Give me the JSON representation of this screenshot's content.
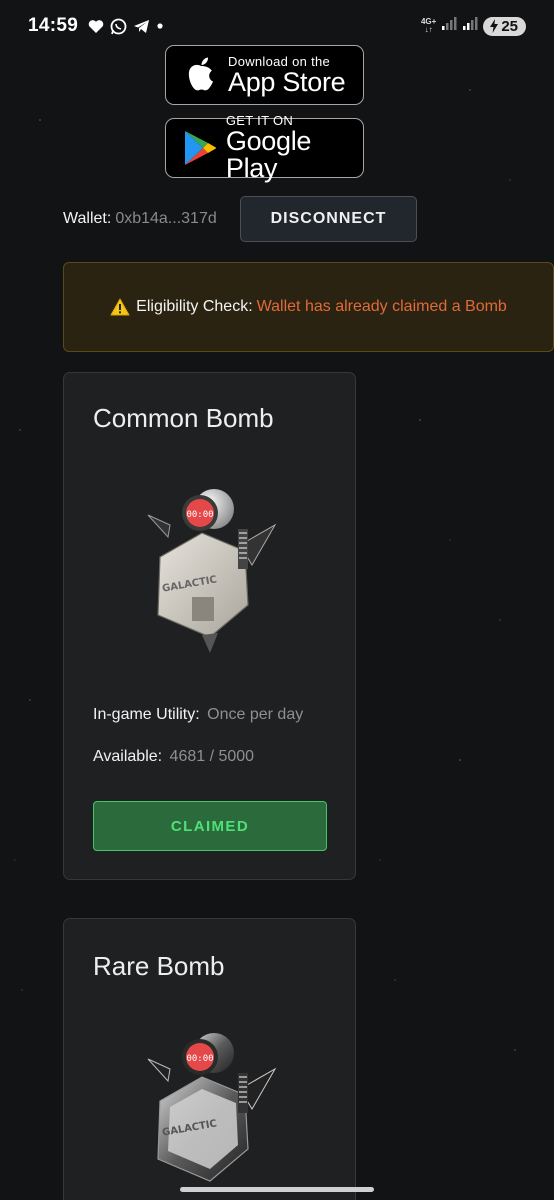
{
  "status_bar": {
    "time": "14:59",
    "left_icons": [
      "heart-icon",
      "whatsapp-icon",
      "telegram-icon",
      "dot-icon"
    ],
    "network": "4G+",
    "battery": "25"
  },
  "stores": {
    "app_store": {
      "small": "Download on the",
      "big": "App Store"
    },
    "google_play": {
      "small": "GET IT ON",
      "big": "Google Play"
    }
  },
  "wallet": {
    "label": "Wallet:",
    "address": "0xb14a...317d",
    "disconnect_label": "DISCONNECT"
  },
  "eligibility": {
    "label": "Eligibility Check:",
    "message": "Wallet has already claimed a Bomb",
    "icon": "warning-icon"
  },
  "cards": [
    {
      "title": "Common Bomb",
      "timer": "00:00",
      "brand": "GALACTIC",
      "utility_label": "In-game Utility:",
      "utility_value": "Once per day",
      "available_label": "Available:",
      "available_value": "4681 / 5000",
      "button_label": "CLAIMED"
    },
    {
      "title": "Rare Bomb",
      "timer": "00:00",
      "brand": "GALACTIC"
    }
  ],
  "colors": {
    "background": "#121314",
    "card": "#1f2022",
    "alert_text": "#e06a3a",
    "claimed_green": "#4ee07a"
  }
}
